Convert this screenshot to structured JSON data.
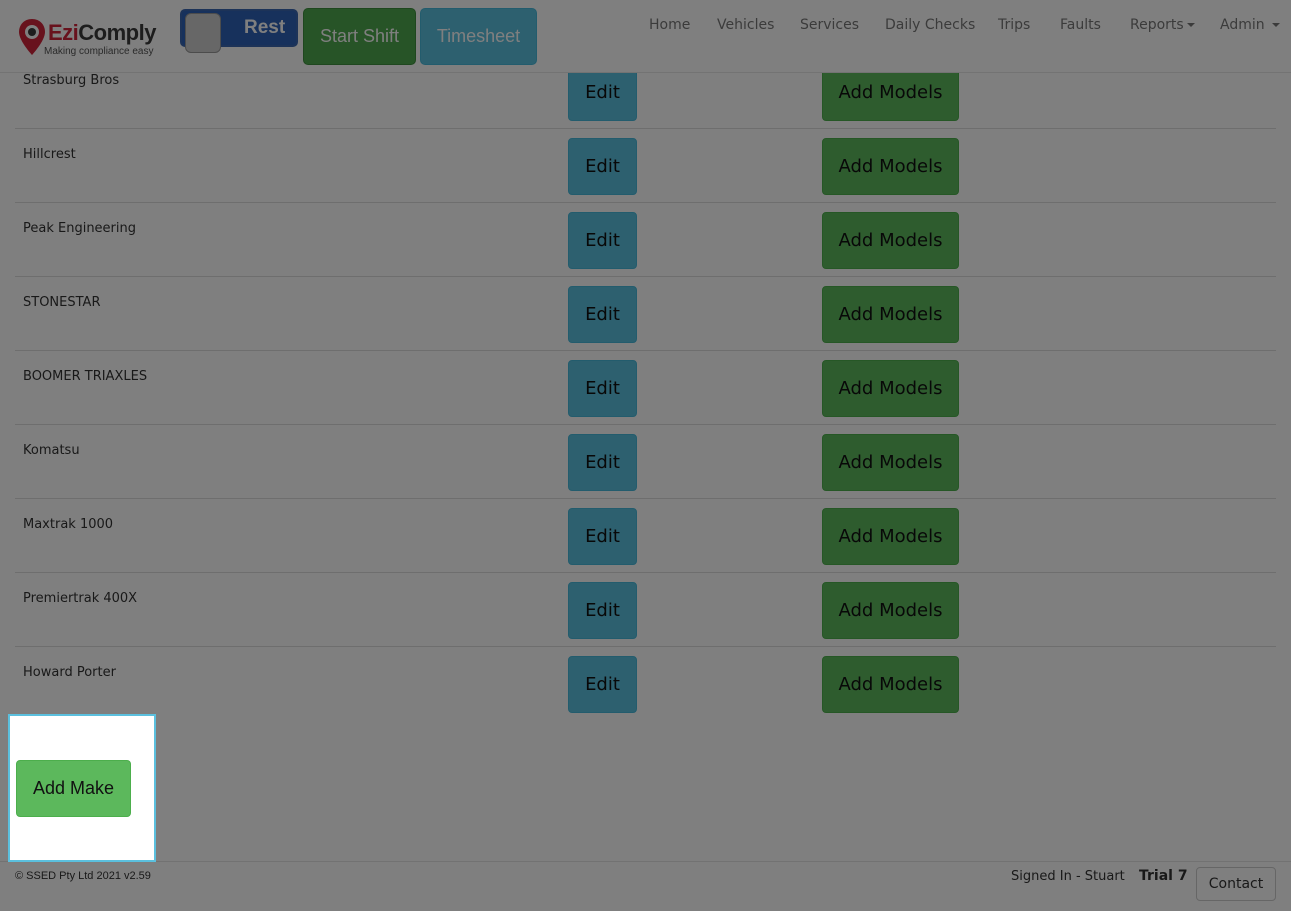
{
  "logo": {
    "brand_ezi": "Ezi",
    "brand_comply": "Comply",
    "tagline": "Making compliance easy"
  },
  "toggle": {
    "label": "Rest"
  },
  "header": {
    "start_shift": "Start Shift",
    "timesheet": "Timesheet"
  },
  "nav": {
    "home": "Home",
    "vehicles": "Vehicles",
    "services": "Services",
    "daily_checks": "Daily Checks",
    "trips": "Trips",
    "faults": "Faults",
    "reports": "Reports",
    "admin": "Admin"
  },
  "table": {
    "edit_label": "Edit",
    "add_models_label": "Add Models",
    "rows": [
      {
        "name": "Strasburg Bros"
      },
      {
        "name": "Hillcrest"
      },
      {
        "name": "Peak Engineering"
      },
      {
        "name": "STONESTAR"
      },
      {
        "name": "BOOMER TRIAXLES"
      },
      {
        "name": "Komatsu"
      },
      {
        "name": "Maxtrak 1000"
      },
      {
        "name": "Premiertrak 400X"
      },
      {
        "name": "Howard Porter"
      }
    ]
  },
  "actions": {
    "add_make": "Add Make"
  },
  "footer": {
    "copyright": "© SSED Pty Ltd 2021    v2.59",
    "signed_in": "Signed In - Stuart",
    "trial": "Trial 7",
    "contact": "Contact"
  },
  "colors": {
    "brand_red": "#d0243a",
    "success": "#5cb85c",
    "info": "#5bc0de",
    "toggle_blue": "#2f62b8"
  }
}
